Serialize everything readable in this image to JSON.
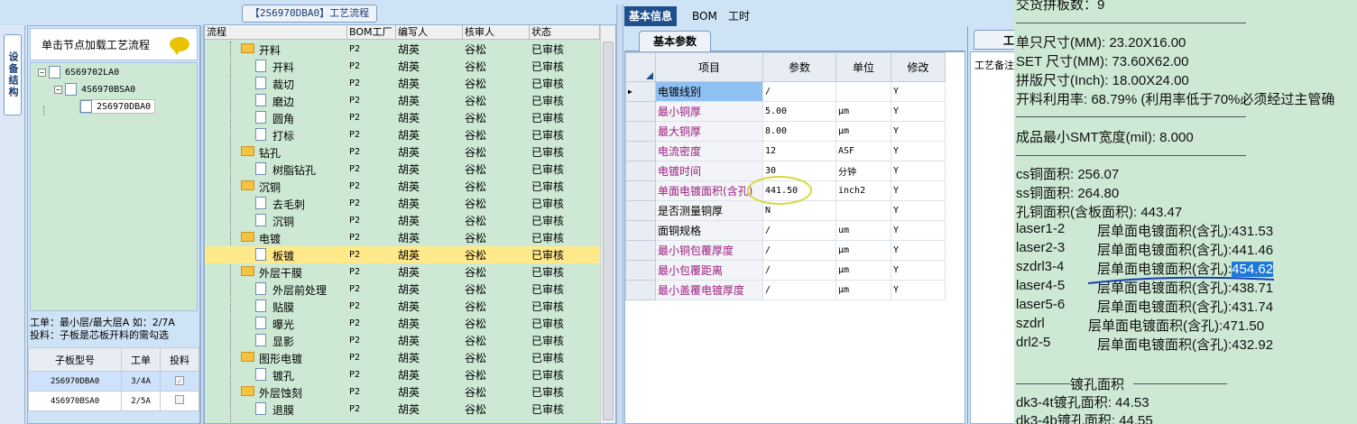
{
  "side_tab": "设备结构",
  "left": {
    "hint": "单击节点加载工艺流程",
    "tree": [
      "6S69702LA0",
      "4S6970BSA0",
      "2S6970DBA0"
    ],
    "info_line1": "工单：最小层/最大层A 如：2/7A",
    "info_line2": "投料：子板是芯板开料的需勾选",
    "sub_table": {
      "headers": [
        "子板型号",
        "工单",
        "投料"
      ],
      "rows": [
        {
          "model": "2S6970DBA0",
          "order": "3/4A",
          "checked": true
        },
        {
          "model": "4S6970BSA0",
          "order": "2/5A",
          "checked": false
        }
      ]
    }
  },
  "flow": {
    "title": "【2S6970DBA0】工艺流程",
    "headers": [
      "流程",
      "BOM工厂",
      "编写人",
      "核审人",
      "状态"
    ],
    "rows": [
      {
        "name": "开料",
        "folder": true,
        "bom": "P2",
        "writer": "胡英",
        "reviewer": "谷松",
        "status": "已审核"
      },
      {
        "name": "开料",
        "folder": false,
        "bom": "P2",
        "writer": "胡英",
        "reviewer": "谷松",
        "status": "已审核"
      },
      {
        "name": "裁切",
        "folder": false,
        "bom": "P2",
        "writer": "胡英",
        "reviewer": "谷松",
        "status": "已审核"
      },
      {
        "name": "磨边",
        "folder": false,
        "bom": "P2",
        "writer": "胡英",
        "reviewer": "谷松",
        "status": "已审核"
      },
      {
        "name": "圆角",
        "folder": false,
        "bom": "P2",
        "writer": "胡英",
        "reviewer": "谷松",
        "status": "已审核"
      },
      {
        "name": "打标",
        "folder": false,
        "bom": "P2",
        "writer": "胡英",
        "reviewer": "谷松",
        "status": "已审核"
      },
      {
        "name": "钻孔",
        "folder": true,
        "bom": "P2",
        "writer": "胡英",
        "reviewer": "谷松",
        "status": "已审核"
      },
      {
        "name": "树脂钻孔",
        "folder": false,
        "bom": "P2",
        "writer": "胡英",
        "reviewer": "谷松",
        "status": "已审核"
      },
      {
        "name": "沉铜",
        "folder": true,
        "bom": "P2",
        "writer": "胡英",
        "reviewer": "谷松",
        "status": "已审核"
      },
      {
        "name": "去毛刺",
        "folder": false,
        "bom": "P2",
        "writer": "胡英",
        "reviewer": "谷松",
        "status": "已审核"
      },
      {
        "name": "沉铜",
        "folder": false,
        "bom": "P2",
        "writer": "胡英",
        "reviewer": "谷松",
        "status": "已审核"
      },
      {
        "name": "电镀",
        "folder": true,
        "bom": "P2",
        "writer": "胡英",
        "reviewer": "谷松",
        "status": "已审核"
      },
      {
        "name": "板镀",
        "folder": false,
        "bom": "P2",
        "writer": "胡英",
        "reviewer": "谷松",
        "status": "已审核",
        "highlight": true
      },
      {
        "name": "外层干膜",
        "folder": true,
        "bom": "P2",
        "writer": "胡英",
        "reviewer": "谷松",
        "status": "已审核"
      },
      {
        "name": "外层前处理",
        "folder": false,
        "bom": "P2",
        "writer": "胡英",
        "reviewer": "谷松",
        "status": "已审核"
      },
      {
        "name": "贴膜",
        "folder": false,
        "bom": "P2",
        "writer": "胡英",
        "reviewer": "谷松",
        "status": "已审核"
      },
      {
        "name": "曝光",
        "folder": false,
        "bom": "P2",
        "writer": "胡英",
        "reviewer": "谷松",
        "status": "已审核"
      },
      {
        "name": "显影",
        "folder": false,
        "bom": "P2",
        "writer": "胡英",
        "reviewer": "谷松",
        "status": "已审核"
      },
      {
        "name": "图形电镀",
        "folder": true,
        "bom": "P2",
        "writer": "胡英",
        "reviewer": "谷松",
        "status": "已审核"
      },
      {
        "name": "镀孔",
        "folder": false,
        "bom": "P2",
        "writer": "胡英",
        "reviewer": "谷松",
        "status": "已审核"
      },
      {
        "name": "外层蚀刻",
        "folder": true,
        "bom": "P2",
        "writer": "胡英",
        "reviewer": "谷松",
        "status": "已审核"
      },
      {
        "name": "退膜",
        "folder": false,
        "bom": "P2",
        "writer": "胡英",
        "reviewer": "谷松",
        "status": "已审核"
      }
    ]
  },
  "params": {
    "tabs": [
      "基本信息",
      "BOM",
      "工时"
    ],
    "sub_tab": "基本参数",
    "headers": [
      "项目",
      "参数",
      "单位",
      "修改"
    ],
    "rows": [
      {
        "item": "电镀线别",
        "value": "/",
        "unit": "",
        "mod": "Y",
        "black": true,
        "selected": true,
        "current": true
      },
      {
        "item": "最小铜厚",
        "value": "5.00",
        "unit": "μm",
        "mod": "Y"
      },
      {
        "item": "最大铜厚",
        "value": "8.00",
        "unit": "μm",
        "mod": "Y"
      },
      {
        "item": "电流密度",
        "value": "12",
        "unit": "ASF",
        "mod": "Y"
      },
      {
        "item": "电镀时间",
        "value": "30",
        "unit": "分钟",
        "mod": "Y"
      },
      {
        "item": "单面电镀面积(含孔)",
        "value": "441.50",
        "unit": "inch2",
        "mod": "Y"
      },
      {
        "item": "是否测量铜厚",
        "value": "N",
        "unit": "",
        "mod": "Y",
        "black": true
      },
      {
        "item": "面铜规格",
        "value": "/",
        "unit": "um",
        "mod": "Y",
        "black": true
      },
      {
        "item": "最小铜包覆厚度",
        "value": "/",
        "unit": "μm",
        "mod": "Y"
      },
      {
        "item": "最小包覆距离",
        "value": "/",
        "unit": "μm",
        "mod": "Y"
      },
      {
        "item": "最小盖覆电镀厚度",
        "value": "/",
        "unit": "μm",
        "mod": "Y"
      }
    ]
  },
  "side_panel": {
    "tab": "工",
    "body": "工艺备注"
  },
  "right": {
    "l1": "交货拼板数：9",
    "l2": "单只尺寸(MM): 23.20X16.00",
    "l3": "SET 尺寸(MM): 73.60X62.00",
    "l4": "拼版尺寸(Inch): 18.00X24.00",
    "l5": "开料利用率: 68.79% (利用率低于70%必须经过主管确",
    "l6": "成品最小SMT宽度(mil): 8.000",
    "l7": "cs铜面积: 256.07",
    "l8": "ss铜面积: 264.80",
    "l9": "孔铜面积(含板面积): 443.47",
    "areas": [
      {
        "layer": "laser1-2",
        "text": "层单面电镀面积(含孔):431.53"
      },
      {
        "layer": "laser2-3",
        "text": "层单面电镀面积(含孔):441.46"
      },
      {
        "layer": "szdrl3-4",
        "text": "层单面电镀面积(含孔):",
        "val": "454.62"
      },
      {
        "layer": "laser4-5",
        "text": "层单面电镀面积(含孔):438.71"
      },
      {
        "layer": "laser5-6",
        "text": "层单面电镀面积(含孔):431.74"
      },
      {
        "layer": "szdrl",
        "text": "层单面电镀面积(含孔):471.50"
      },
      {
        "layer": "drl2-5",
        "text": "层单面电镀面积(含孔):432.92"
      }
    ],
    "hole_title": "镀孔面积",
    "h1": "dk3-4t镀孔面积: 44.53",
    "h2": "dk3-4b镀孔面积: 44.55"
  }
}
